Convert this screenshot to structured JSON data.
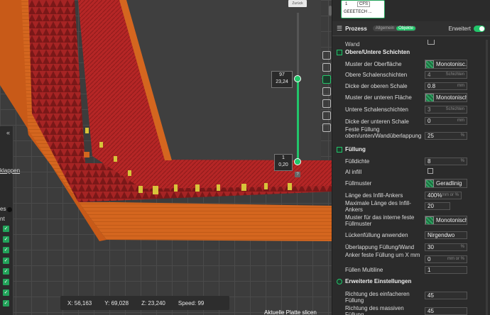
{
  "viewport": {
    "zurueck_label": "Zurück",
    "slider_top_layer": "97",
    "slider_top_height": "23,24",
    "slider_bottom_layer": "1",
    "slider_bottom_height": "0,20",
    "slider_help": "?",
    "left_fragment_1": "klappen",
    "left_fragment_2": "es",
    "left_fragment_3": "nt",
    "chevron": "«",
    "status": {
      "x": "X: 56,163",
      "y": "Y: 69,028",
      "z": "Z: 23,240",
      "speed": "Speed: 99"
    },
    "aktuell": "Aktuelle Platte slicen"
  },
  "printer": {
    "number": "1",
    "filament": "CFS",
    "name": "GEEETECH ..."
  },
  "header": {
    "title": "Prozess",
    "tab_allgemein": "Allgemein",
    "tab_objekte": "Objekte",
    "erweitert": "Erweitert"
  },
  "colors": {
    "accent": "#22c56a",
    "model_red": "#b52626",
    "model_orange": "#d4661f",
    "infill_yellow": "#d7c43a"
  },
  "sections": {
    "wand_label": "Wand",
    "obere_untere": "Obere/Untere Schichten",
    "fuellung": "Füllung",
    "erweiterte": "Erweiterte Einstellungen"
  },
  "fields": {
    "muster_oberflaeche": {
      "label": "Muster der Oberfläche",
      "value": "Monotonisc..."
    },
    "obere_schalen": {
      "label": "Obere Schalenschichten",
      "value": "4",
      "unit": "Schichten"
    },
    "dicke_obere": {
      "label": "Dicke der oberen Schale",
      "value": "0.8",
      "unit": "mm"
    },
    "muster_untere": {
      "label": "Muster der unteren Fläche",
      "value": "Monotonisch"
    },
    "untere_schalen": {
      "label": "Untere Schalenschichten",
      "value": "3",
      "unit": "Schichten"
    },
    "dicke_untere": {
      "label": "Dicke der unteren Schale",
      "value": "0",
      "unit": "mm"
    },
    "feste_fuellung_ueberlappung": {
      "label": "Feste Füllung oben/unten/Wandüberlappung",
      "value": "25",
      "unit": "%"
    },
    "fuelldichte": {
      "label": "Fülldichte",
      "value": "8",
      "unit": "%"
    },
    "al_infill": {
      "label": "Al infill"
    },
    "fuellmuster": {
      "label": "Füllmuster",
      "value": "Geradlinig"
    },
    "laenge_infill_anker": {
      "label": "Länge des Infill-Ankers",
      "value": "400%",
      "unit": "mm or %"
    },
    "max_laenge_anker": {
      "label": "Maximale Länge des Infill-Ankers",
      "value": "20"
    },
    "muster_interne": {
      "label": "Muster für das interne feste Füllmuster",
      "value": "Monotonisch"
    },
    "lueckenfuellung": {
      "label": "Lückenfüllung anwenden",
      "value": "Nirgendwo"
    },
    "ueberlappung_wand": {
      "label": "Überlappung Füllung/Wand",
      "value": "30",
      "unit": "%"
    },
    "anker_feste": {
      "label": "Anker feste Füllung um X mm",
      "value": "0",
      "unit": "mm or %"
    },
    "fuellen_multiline": {
      "label": "Füllen Multiline",
      "value": "1"
    },
    "richtung_einfach": {
      "label": "Richtung des einfacheren Füllung",
      "value": "45"
    },
    "richtung_massiv": {
      "label": "Richtung des massiven Füllung",
      "value": "45"
    }
  }
}
